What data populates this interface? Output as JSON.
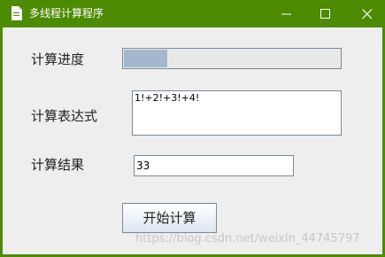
{
  "window": {
    "title": "多线程计算程序",
    "accent": "#4c8b02"
  },
  "form": {
    "progress_label": "计算进度",
    "progress_value": 0.2,
    "expression_label": "计算表达式",
    "expression_value": "1!+2!+3!+4!",
    "result_label": "计算结果",
    "result_value": "33",
    "start_button": "开始计算"
  },
  "watermark": "https://blog.csdn.net/weixin_44745797",
  "icons": [
    "java-app-icon",
    "minimize-icon",
    "maximize-icon",
    "close-icon"
  ]
}
